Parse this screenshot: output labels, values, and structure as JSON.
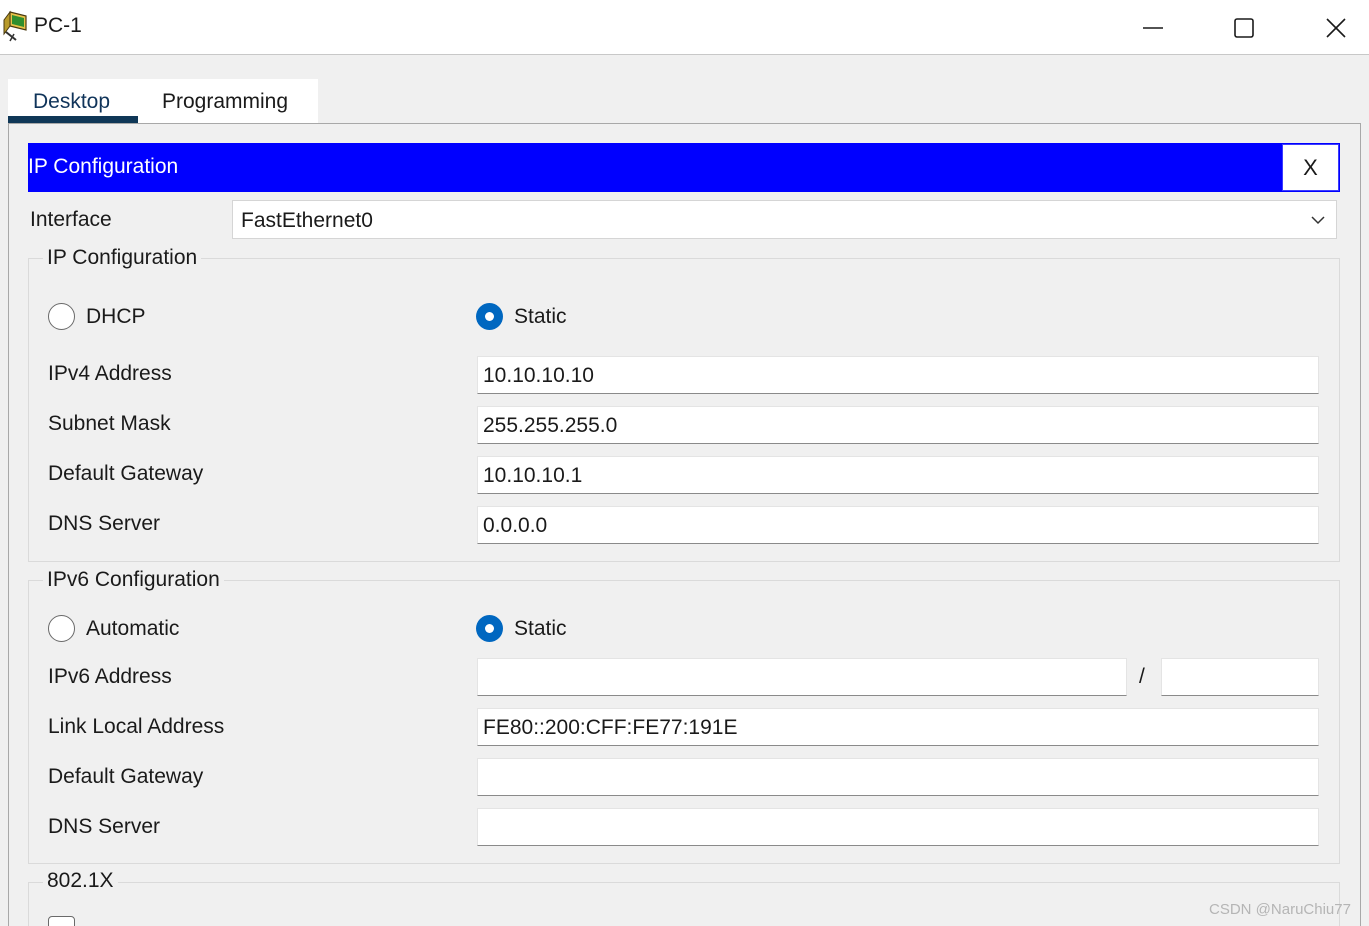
{
  "window": {
    "title": "PC-1",
    "icon": "pc-app-icon",
    "controls": {
      "minimize": "minimize-icon",
      "maximize": "maximize-icon",
      "close": "close-icon"
    }
  },
  "tabs": [
    {
      "label": "Desktop",
      "active": true
    },
    {
      "label": "Programming",
      "active": false
    }
  ],
  "panel": {
    "title": "IP Configuration",
    "close_label": "X",
    "header_color": "#0000ff"
  },
  "interface": {
    "label": "Interface",
    "value": "FastEthernet0"
  },
  "ipv4": {
    "group_title": "IP Configuration",
    "dhcp_label": "DHCP",
    "static_label": "Static",
    "mode": "Static",
    "address_label": "IPv4 Address",
    "address_value": "10.10.10.10",
    "mask_label": "Subnet Mask",
    "mask_value": "255.255.255.0",
    "gateway_label": "Default Gateway",
    "gateway_value": "10.10.10.1",
    "dns_label": "DNS Server",
    "dns_value": "0.0.0.0"
  },
  "ipv6": {
    "group_title": "IPv6 Configuration",
    "auto_label": "Automatic",
    "static_label": "Static",
    "mode": "Static",
    "address_label": "IPv6 Address",
    "address_value": "",
    "prefix_separator": "/",
    "prefix_value": "",
    "link_local_label": "Link Local Address",
    "link_local_value": "FE80::200:CFF:FE77:191E",
    "gateway_label": "Default Gateway",
    "gateway_value": "",
    "dns_label": "DNS Server",
    "dns_value": ""
  },
  "dot1x": {
    "group_title": "802.1X"
  },
  "watermark": "CSDN @NaruChiu77"
}
